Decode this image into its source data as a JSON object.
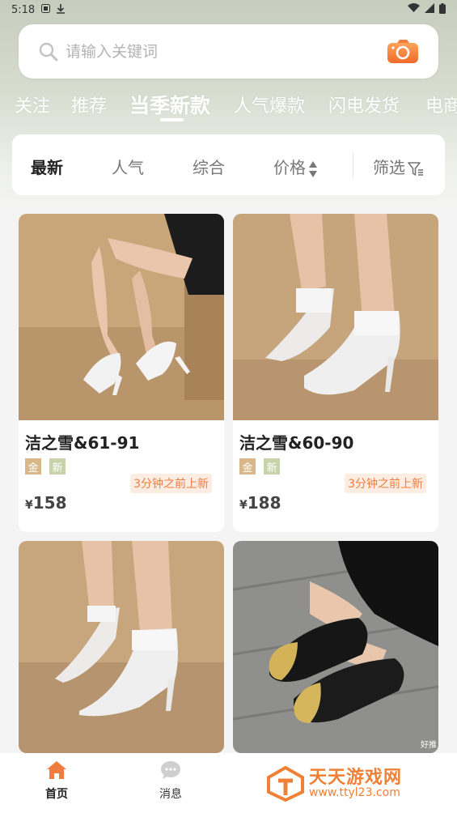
{
  "status_bar": {
    "time": "5:18"
  },
  "search": {
    "placeholder": "请输入关键词"
  },
  "category_tabs": [
    {
      "label": "关注"
    },
    {
      "label": "推荐"
    },
    {
      "label": "当季新款"
    },
    {
      "label": "人气爆款"
    },
    {
      "label": "闪电发货"
    },
    {
      "label": "电商"
    }
  ],
  "active_category": "当季新款",
  "sort_bar": {
    "latest": "最新",
    "popularity": "人气",
    "overall": "综合",
    "price": "价格",
    "filter": "筛选"
  },
  "products": [
    {
      "title": "洁之雪&61-91",
      "tag_gold": "金",
      "tag_new": "新",
      "time": "3分钟之前上新",
      "currency": "¥",
      "price": "158"
    },
    {
      "title": "洁之雪&60-90",
      "tag_gold": "金",
      "tag_new": "新",
      "time": "3分钟之前上新",
      "currency": "¥",
      "price": "188"
    },
    {
      "title": "",
      "tag_gold": "",
      "tag_new": "",
      "time": "",
      "currency": "",
      "price": ""
    },
    {
      "title": "",
      "tag_gold": "",
      "tag_new": "",
      "time": "",
      "currency": "",
      "price": ""
    }
  ],
  "bottom_nav": {
    "home": "首页",
    "messages": "消息"
  },
  "watermark": {
    "title": "天天游戏网",
    "url": "www.ttyl23.com",
    "small_text": "好推"
  },
  "colors": {
    "accent": "#f07d40",
    "gold_tag": "#d8b88a",
    "new_tag": "#c7d3a8",
    "header_bg": "#c6cdbd"
  },
  "icons": [
    "search-icon",
    "camera-icon",
    "sort-arrows-icon",
    "filter-icon",
    "home-icon",
    "message-icon",
    "wifi-icon",
    "signal-icon",
    "battery-icon"
  ]
}
